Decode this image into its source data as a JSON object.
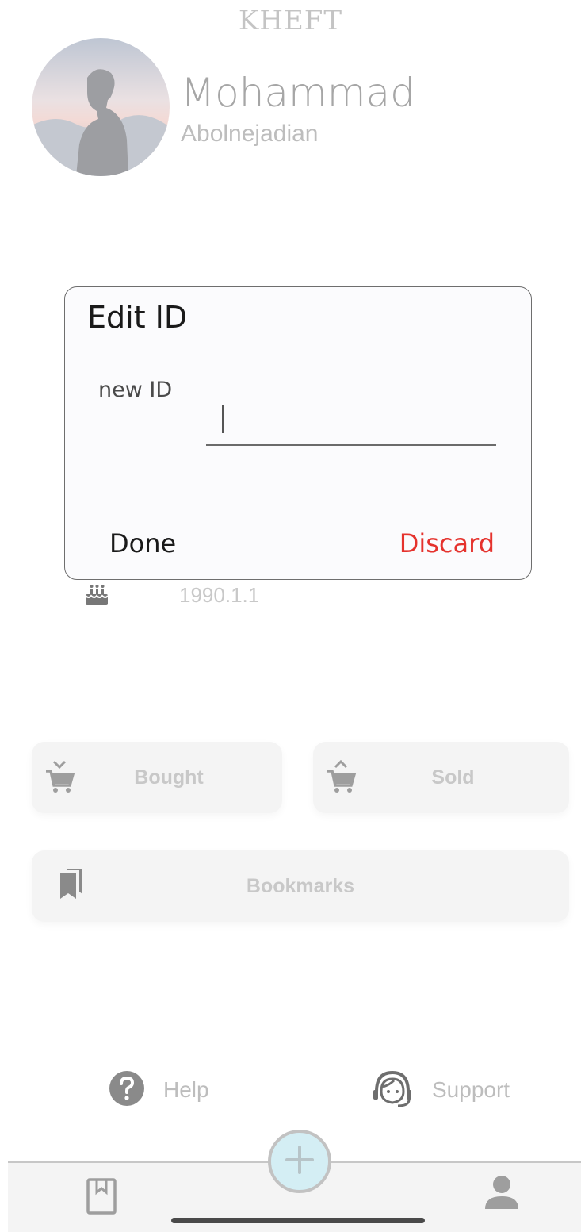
{
  "app": {
    "title": "KHEFT"
  },
  "profile": {
    "first_name": "Mohammad",
    "last_name": "Abolnejadian",
    "birthday": "1990.1.1"
  },
  "cards": {
    "bought": "Bought",
    "sold": "Sold",
    "bookmarks": "Bookmarks"
  },
  "links": {
    "help": "Help",
    "support": "Support"
  },
  "dialog": {
    "title": "Edit ID",
    "field_label": "new ID",
    "input_value": "",
    "done_label": "Done",
    "discard_label": "Discard"
  },
  "colors": {
    "accent_danger": "#e5322d",
    "fab_fill": "#d4eef4",
    "muted": "#c8c8c8"
  },
  "icons": {
    "birthday": "cake-icon",
    "bought": "cart-down-icon",
    "sold": "cart-up-icon",
    "bookmarks": "bookmarks-icon",
    "help": "help-circle-icon",
    "support": "headset-icon",
    "nav_bookmark": "bookmark-outline-icon",
    "fab": "plus-icon",
    "nav_profile": "person-icon"
  }
}
